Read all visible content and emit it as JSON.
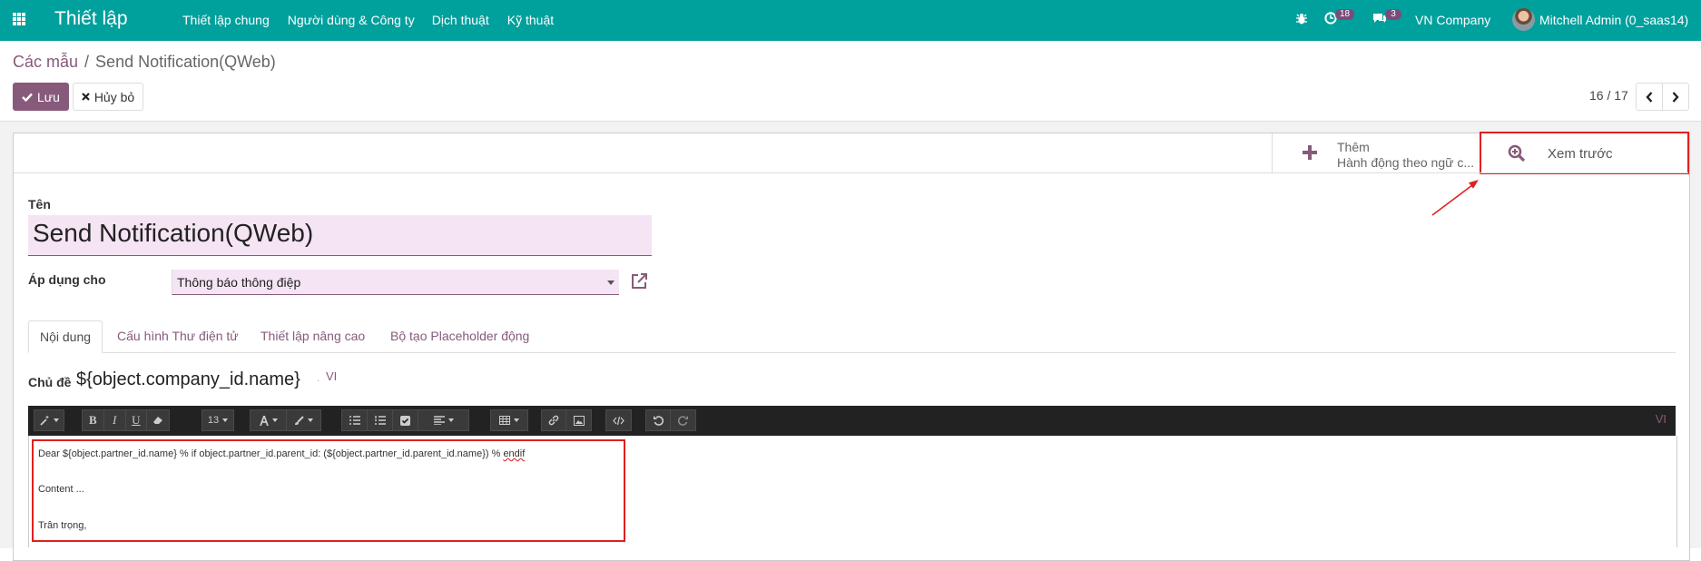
{
  "navbar": {
    "app_title": "Thiết lập",
    "menus": [
      "Thiết lập chung",
      "Người dùng & Công ty",
      "Dịch thuật",
      "Kỹ thuật"
    ],
    "activity_count": "18",
    "message_count": "3",
    "company": "VN Company",
    "user": "Mitchell Admin (0_saas14)"
  },
  "breadcrumb": {
    "parent": "Các mẫu",
    "separator": "/",
    "current": "Send Notification(QWeb)"
  },
  "actions": {
    "save_label": "Lưu",
    "discard_label": "Hủy bỏ"
  },
  "pager": {
    "value": "16 / 17"
  },
  "button_box": {
    "add_title": "Thêm",
    "add_subtitle": "Hành động theo ngữ c...",
    "preview_label": "Xem trước"
  },
  "form": {
    "name_label": "Tên",
    "name_value": "Send Notification(QWeb)",
    "model_label": "Áp dụng cho",
    "model_value": "Thông báo thông điệp",
    "tabs": [
      "Nội dung",
      "Cấu hình Thư điện tử",
      "Thiết lập nâng cao",
      "Bộ tạo Placeholder động"
    ],
    "subject_label": "Chủ đề",
    "subject_value": "${object.company_id.name}",
    "subject_dot": "·",
    "subject_lang": "VI"
  },
  "editor": {
    "font_size": "13",
    "lang": "VI",
    "body_line1_pre": "Dear ${object.partner_id.name} % if object.partner_id.parent_id: (${object.partner_id.parent_id.name}) % ",
    "body_line1_endif": "endif",
    "body_line2": "Content ...",
    "body_line3": "Trân trọng,"
  },
  "colors": {
    "navbar": "#00a09d",
    "primary": "#875a7b",
    "highlight": "#e02020",
    "field_bg": "#f5e5f4"
  }
}
